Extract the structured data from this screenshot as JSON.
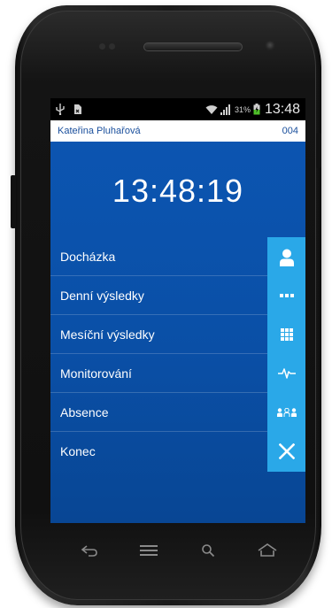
{
  "status_bar": {
    "usb_icon": "usb-icon",
    "sim_icon": "sim-card-icon",
    "wifi_icon": "wifi-icon",
    "signal_icon": "signal-icon",
    "battery_percent": "31%",
    "battery_icon": "battery-charging-icon",
    "time": "13:48"
  },
  "user_bar": {
    "name": "Kateřina Pluhařová",
    "number": "004"
  },
  "clock": {
    "time": "13:48:19"
  },
  "menu": {
    "items": [
      {
        "label": "Docházka",
        "icon": "person-icon"
      },
      {
        "label": "Denní výsledky",
        "icon": "dots-icon"
      },
      {
        "label": "Mesíční výsledky",
        "icon": "grid-icon"
      },
      {
        "label": "Monitorování",
        "icon": "pulse-icon"
      },
      {
        "label": "Absence",
        "icon": "group-icon"
      },
      {
        "label": "Konec",
        "icon": "close-icon"
      }
    ]
  },
  "nav_keys": {
    "back": "back-icon",
    "menu": "menu-icon",
    "search": "search-icon",
    "home": "home-icon"
  },
  "colors": {
    "screen_blue": "#0c56b3",
    "icon_box": "#2aa8e8",
    "user_text": "#1a4f9c"
  }
}
